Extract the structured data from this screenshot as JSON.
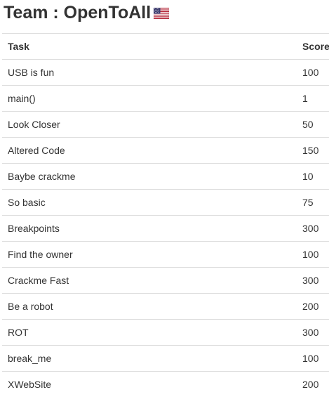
{
  "header": {
    "title": "Team : OpenToAll",
    "flag_icon": "us-flag-icon"
  },
  "table": {
    "columns": [
      "Task",
      "Score"
    ],
    "rows": [
      {
        "task": "USB is fun",
        "score": "100"
      },
      {
        "task": "main()",
        "score": "1"
      },
      {
        "task": "Look Closer",
        "score": "50"
      },
      {
        "task": "Altered Code",
        "score": "150"
      },
      {
        "task": "Baybe crackme",
        "score": "10"
      },
      {
        "task": "So basic",
        "score": "75"
      },
      {
        "task": "Breakpoints",
        "score": "300"
      },
      {
        "task": "Find the owner",
        "score": "100"
      },
      {
        "task": "Crackme Fast",
        "score": "300"
      },
      {
        "task": "Be a robot",
        "score": "200"
      },
      {
        "task": "ROT",
        "score": "300"
      },
      {
        "task": "break_me",
        "score": "100"
      },
      {
        "task": "XWebSite",
        "score": "200"
      }
    ]
  },
  "colors": {
    "text": "#333333",
    "border": "#dddddd",
    "flag_red": "#b22234",
    "flag_blue": "#3c3b6e"
  }
}
